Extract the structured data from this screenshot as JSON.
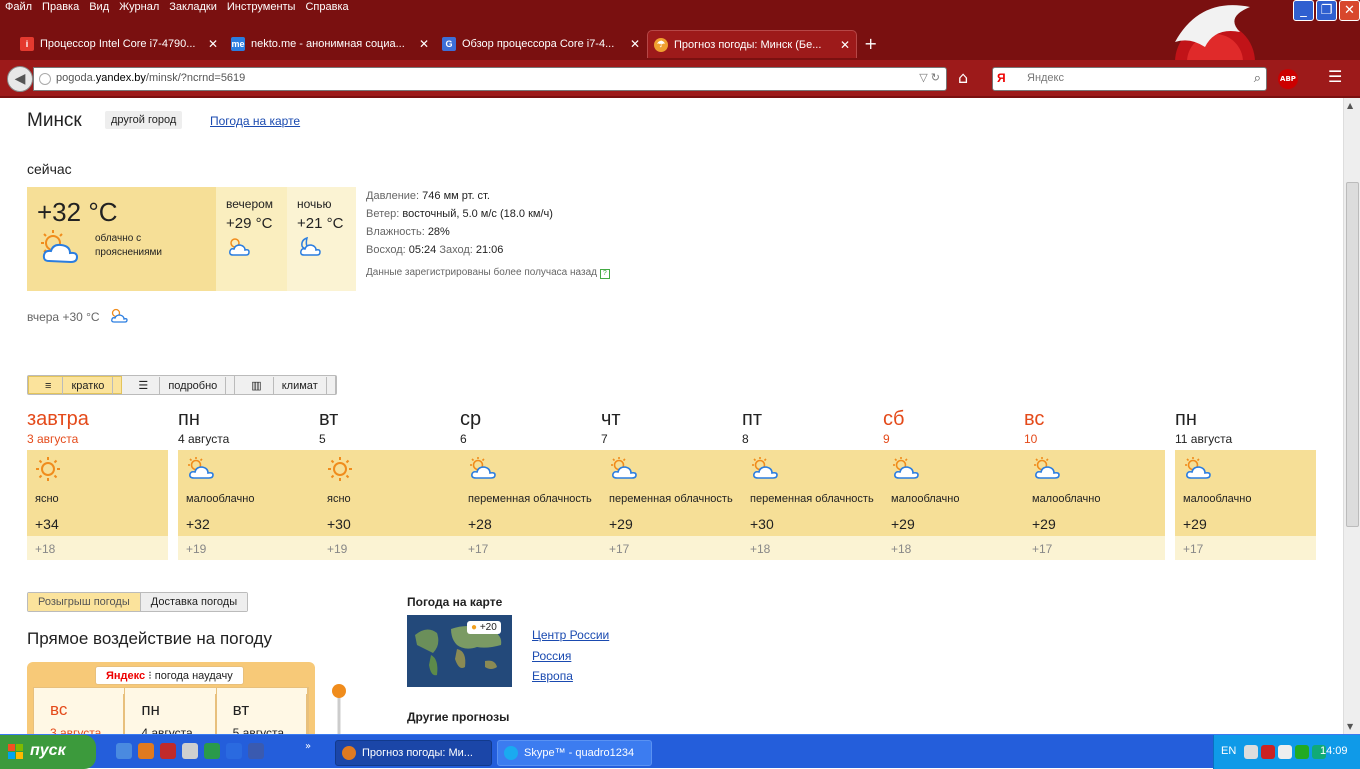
{
  "menubar": [
    "Файл",
    "Правка",
    "Вид",
    "Журнал",
    "Закладки",
    "Инструменты",
    "Справка"
  ],
  "tabs": [
    {
      "title": "Процессор Intel Core i7-4790...",
      "icon": "intel-favicon",
      "color": "#e43a2f"
    },
    {
      "title": "nekto.me - анонимная социа...",
      "icon": "nekto-favicon",
      "color": "#2a7de0"
    },
    {
      "title": "Обзор процессора Core i7-4...",
      "icon": "review-favicon",
      "color": "#3d6fd8"
    },
    {
      "title": "Прогноз погоды: Минск (Бе...",
      "icon": "yandex-weather-favicon",
      "color": "#f0a030"
    }
  ],
  "url": {
    "prefix": "pogoda.",
    "domain": "yandex.by",
    "path": "/minsk/?ncrnd=5619"
  },
  "search": {
    "placeholder": "Яндекс",
    "engine_letter": "Я"
  },
  "abp_label": "ABP",
  "page": {
    "city": "Минск",
    "other_city": "другой город",
    "map_link": "Погода на карте",
    "now_label": "сейчас",
    "now_temp": "+32 °C",
    "now_cond": "облачно с прояснениями",
    "evening_label": "вечером",
    "evening_temp": "+29 °C",
    "night_label": "ночью",
    "night_temp": "+21 °C",
    "pressure_label": "Давление: ",
    "pressure_value": "746 мм рт. ст.",
    "wind_label": "Ветер: ",
    "wind_value": "восточный, 5.0 м/с (18.0 км/ч)",
    "humidity_label": "Влажность: ",
    "humidity_value": "28%",
    "sunrise_label": "Восход: ",
    "sunrise_value": "05:24",
    "sunset_label": " Заход: ",
    "sunset_value": "21:06",
    "data_note": "Данные зарегистрированы более получаса назад",
    "help_mark": "?",
    "yesterday": "вчера +30 °C",
    "view_tabs": [
      "кратко",
      "подробно",
      "климат"
    ]
  },
  "forecast": [
    {
      "name": "завтра",
      "date": "3 августа",
      "cond": "ясно",
      "max": "+34",
      "min": "+18",
      "icon": "sun",
      "weekend": true,
      "light": false
    },
    {
      "name": "пн",
      "date": "4 августа",
      "cond": "малооблачно",
      "max": "+32",
      "min": "+19",
      "icon": "sun-cloud",
      "weekend": false,
      "light": false
    },
    {
      "name": "вт",
      "date": "5",
      "cond": "ясно",
      "max": "+30",
      "min": "+19",
      "icon": "sun",
      "weekend": false,
      "light": false
    },
    {
      "name": "ср",
      "date": "6",
      "cond": "переменная облачность",
      "max": "+28",
      "min": "+17",
      "icon": "sun-cloud",
      "weekend": false,
      "light": false
    },
    {
      "name": "чт",
      "date": "7",
      "cond": "переменная облачность",
      "max": "+29",
      "min": "+17",
      "icon": "sun-cloud",
      "weekend": false,
      "light": false
    },
    {
      "name": "пт",
      "date": "8",
      "cond": "переменная облачность",
      "max": "+30",
      "min": "+18",
      "icon": "sun-cloud",
      "weekend": false,
      "light": false
    },
    {
      "name": "сб",
      "date": "9",
      "cond": "малооблачно",
      "max": "+29",
      "min": "+18",
      "icon": "sun-cloud",
      "weekend": true,
      "light": false
    },
    {
      "name": "вс",
      "date": "10",
      "cond": "малооблачно",
      "max": "+29",
      "min": "+17",
      "icon": "sun-cloud",
      "weekend": true,
      "light": false
    },
    {
      "name": "пн",
      "date": "11 августа",
      "cond": "малооблачно",
      "max": "+29",
      "min": "+17",
      "icon": "sun-cloud",
      "weekend": false,
      "light": false
    }
  ],
  "promo": {
    "tabs": [
      "Розыгрыш погоды",
      "Доставка погоды"
    ],
    "title": "Прямое воздействие на погоду",
    "brand": "Яндекс",
    "label": "погода наудачу",
    "days": [
      {
        "name": "вс",
        "date": "3 августа",
        "weekend": true
      },
      {
        "name": "пн",
        "date": "4 августа",
        "weekend": false
      },
      {
        "name": "вт",
        "date": "5 августа",
        "weekend": false
      }
    ]
  },
  "map": {
    "title": "Погода на карте",
    "badge": "+20",
    "links": [
      "Центр России",
      "Россия",
      "Европа"
    ],
    "other_title": "Другие прогнозы"
  },
  "taskbar": {
    "start": "пуск",
    "tasks": [
      {
        "label": "Прогноз погоды: Ми...",
        "active": true
      },
      {
        "label": "Skype™ - quadro1234",
        "active": false
      }
    ],
    "lang": "EN",
    "clock": "14:09"
  }
}
